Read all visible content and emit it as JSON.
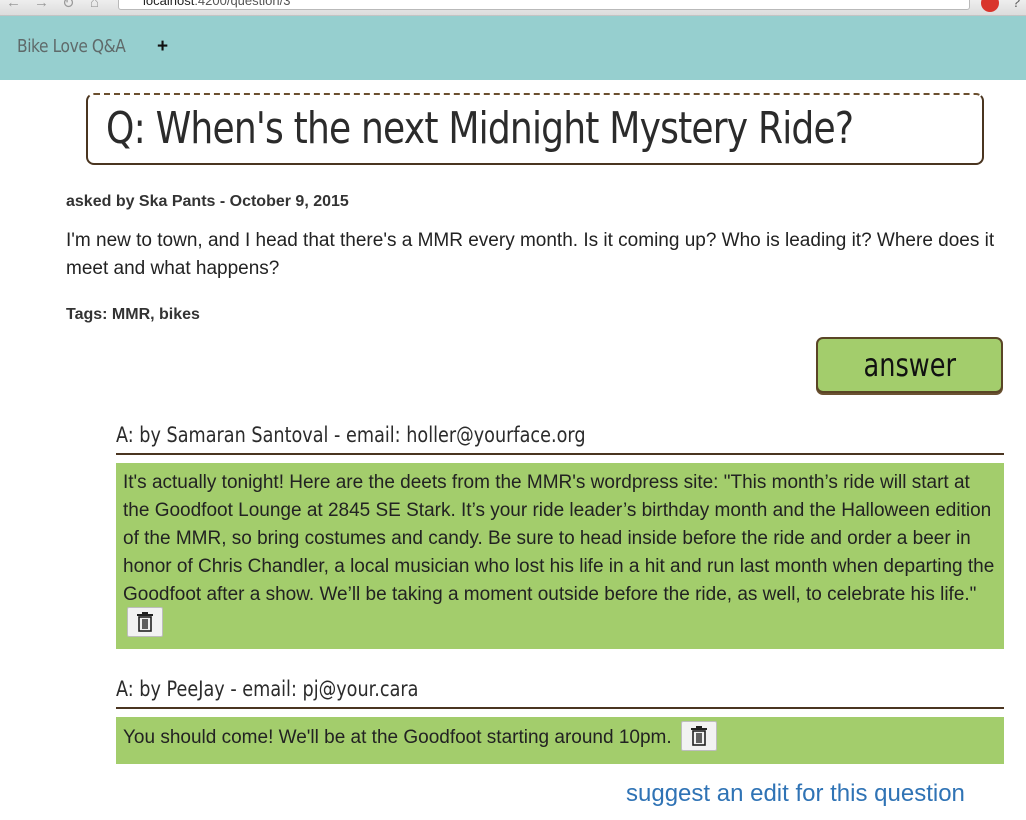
{
  "browser": {
    "url_host": "localhost",
    "url_rest": ":4200/question/3"
  },
  "navbar": {
    "brand": "Bike Love Q&A",
    "plus_label": "+"
  },
  "question": {
    "title": "Q: When's the next Midnight Mystery Ride?",
    "asked_by": "asked by Ska Pants - October 9, 2015",
    "body": "I'm new to town, and I head that there's a MMR every month. Is it coming up? Who is leading it? Where does it meet and what happens?",
    "tags_label": "Tags: MMR, bikes"
  },
  "answer_button": "answer",
  "answers": [
    {
      "header": "A: by Samaran Santoval - email: holler@yourface.org",
      "body": "It's actually tonight! Here are the deets from the MMR's wordpress site: \"This month’s ride will start at the Goodfoot Lounge at 2845 SE Stark. It’s your ride leader’s birthday month and the Halloween edition of the MMR, so bring costumes and candy. Be sure to head inside before the ride and order a beer in honor of Chris Chandler, a local musician who lost his life in a hit and run last month when departing the Goodfoot after a show. We’ll be taking a moment outside before the ride, as well, to celebrate his life.\""
    },
    {
      "header": "A: by PeeJay - email: pj@your.cara",
      "body": "You should come! We'll be at the Goodfoot starting around 10pm."
    }
  ],
  "suggest_link": "suggest an edit for this question",
  "colors": {
    "navbar": "#96cfcf",
    "answer_green": "#a3cd6c",
    "border_brown": "#4a3520",
    "link_blue": "#2f73b5"
  }
}
